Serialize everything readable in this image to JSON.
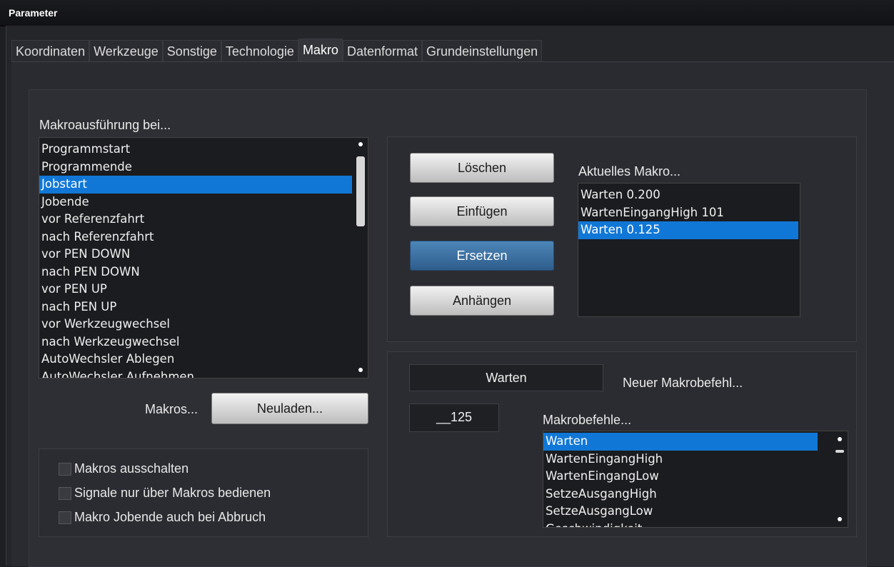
{
  "window": {
    "title": "Parameter"
  },
  "tabs": [
    {
      "label": "Koordinaten",
      "active": false
    },
    {
      "label": "Werkzeuge",
      "active": false
    },
    {
      "label": "Sonstige",
      "active": false
    },
    {
      "label": "Technologie",
      "active": false
    },
    {
      "label": "Makro",
      "active": true
    },
    {
      "label": "Datenformat",
      "active": false
    },
    {
      "label": "Grundeinstellungen",
      "active": false
    }
  ],
  "execution": {
    "label": "Makroausführung bei...",
    "items": [
      "Programmstart",
      "Programmende",
      "Jobstart",
      "Jobende",
      "vor Referenzfahrt",
      "nach Referenzfahrt",
      "vor PEN DOWN",
      "nach PEN DOWN",
      "vor PEN UP",
      "nach PEN UP",
      "vor Werkzeugwechsel",
      "nach Werkzeugwechsel",
      "AutoWechsler Ablegen",
      "AutoWechsler Aufnehmen"
    ],
    "selected_index": 2
  },
  "reload": {
    "label": "Makros...",
    "button": "Neuladen..."
  },
  "options": [
    {
      "label": "Makros ausschalten",
      "checked": false
    },
    {
      "label": "Signale nur über Makros bedienen",
      "checked": false
    },
    {
      "label": "Makro Jobende auch bei Abbruch",
      "checked": false
    }
  ],
  "buttons": {
    "delete": "Löschen",
    "insert": "Einfügen",
    "replace": "Ersetzen",
    "append": "Anhängen"
  },
  "current_macro": {
    "label": "Aktuelles Makro...",
    "items": [
      "Warten  0.200",
      "WartenEingangHigh 101",
      "Warten  0.125"
    ],
    "selected_index": 2
  },
  "new_command": {
    "command_value": "Warten",
    "label": "Neuer Makrobefehl...",
    "param_value": "__125"
  },
  "commands": {
    "label": "Makrobefehle...",
    "items": [
      "Warten",
      "WartenEingangHigh",
      "WartenEingangLow",
      "SetzeAusgangHigh",
      "SetzeAusgangLow",
      "Geschwindigkeit"
    ],
    "selected_index": 0
  },
  "colors": {
    "selection": "#1177d6",
    "accent_button": "#3a6e9f"
  }
}
